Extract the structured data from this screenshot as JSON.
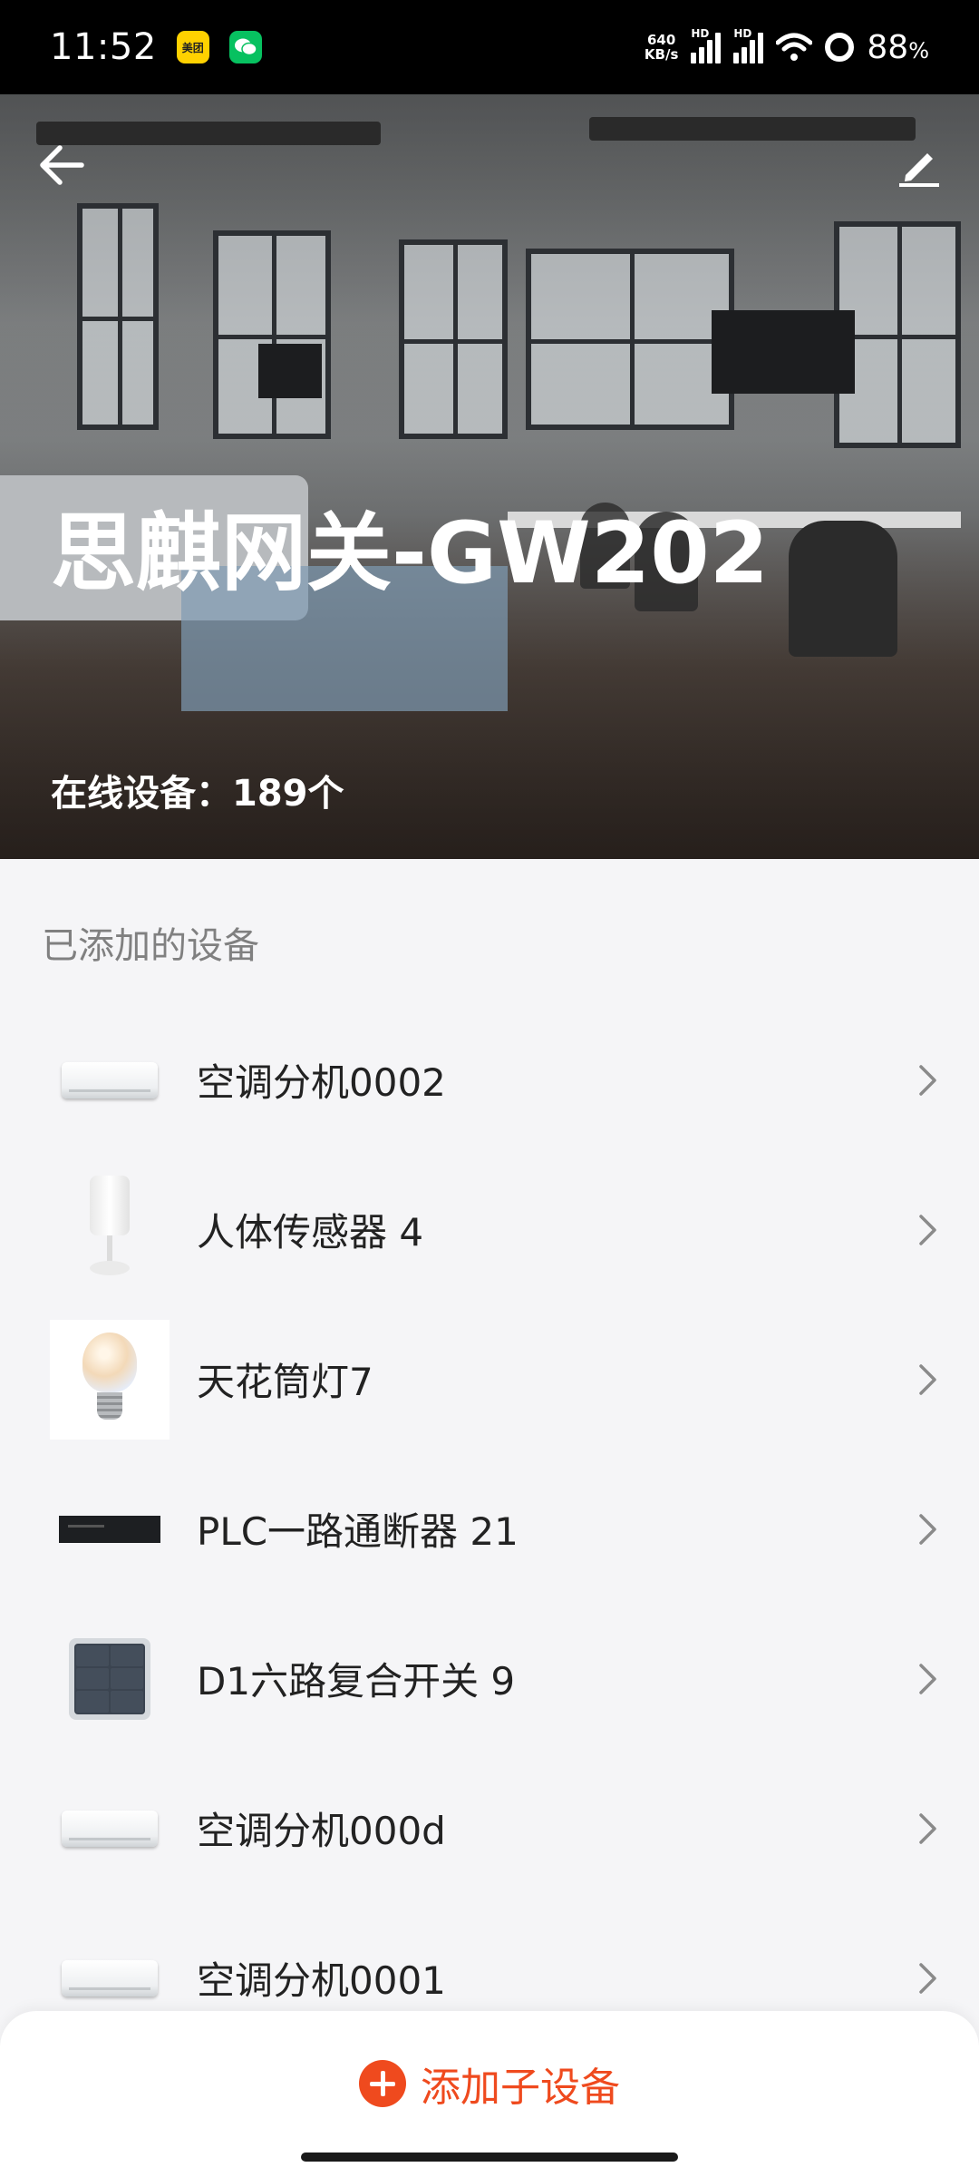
{
  "status_bar": {
    "time": "11:52",
    "net_speed_value": "640",
    "net_speed_unit": "KB/s",
    "hd_label": "HD",
    "battery_percent": "88",
    "battery_unit": "%",
    "meituan_badge": "美团"
  },
  "hero": {
    "title": "思麒网关-GW202",
    "online_devices": "在线设备：189个"
  },
  "section": {
    "label": "已添加的设备"
  },
  "devices": [
    {
      "name": "空调分机0002",
      "icon": "air-conditioner"
    },
    {
      "name": "人体传感器 4",
      "icon": "motion-sensor"
    },
    {
      "name": "天花筒灯7",
      "icon": "light-bulb"
    },
    {
      "name": "PLC一路通断器 21",
      "icon": "plc-relay"
    },
    {
      "name": "D1六路复合开关 9",
      "icon": "six-gang-switch"
    },
    {
      "name": "空调分机000d",
      "icon": "air-conditioner"
    },
    {
      "name": "空调分机0001",
      "icon": "air-conditioner"
    }
  ],
  "bottom": {
    "add_label": "添加子设备"
  },
  "colors": {
    "accent": "#ef4a1e",
    "background": "#f5f5f7"
  }
}
